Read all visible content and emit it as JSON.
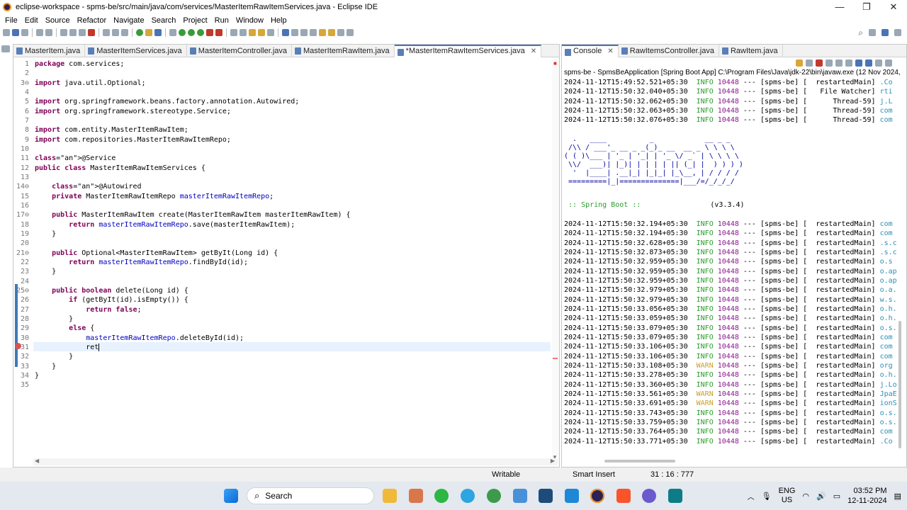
{
  "window": {
    "title": "eclipse-workspace - spms-be/src/main/java/com/services/MasterItemRawItemServices.java - Eclipse IDE",
    "controls": {
      "minimize": "—",
      "maximize": "❐",
      "close": "✕"
    }
  },
  "menu": [
    "File",
    "Edit",
    "Source",
    "Refactor",
    "Navigate",
    "Search",
    "Project",
    "Run",
    "Window",
    "Help"
  ],
  "editor": {
    "tabs": [
      {
        "label": "MasterItem.java"
      },
      {
        "label": "MasterItemServices.java"
      },
      {
        "label": "MasterItemController.java"
      },
      {
        "label": "MasterItemRawItem.java"
      },
      {
        "label": "*MasterItemRawItemServices.java",
        "active": true
      }
    ],
    "line_numbers": [
      "1",
      "2",
      "3⊖",
      "4",
      "5",
      "6",
      "7",
      "8",
      "9",
      "10",
      "11",
      "12",
      "13",
      "14⊖",
      "15",
      "16",
      "17⊖",
      "18",
      "19",
      "20",
      "21⊖",
      "22",
      "23",
      "24",
      "25⊖",
      "26",
      "27",
      "28",
      "29",
      "30",
      "31",
      "32",
      "33",
      "34",
      "35"
    ],
    "lines": [
      "package com.services;",
      "",
      "import java.util.Optional;",
      "",
      "import org.springframework.beans.factory.annotation.Autowired;",
      "import org.springframework.stereotype.Service;",
      "",
      "import com.entity.MasterItemRawItem;",
      "import com.repositories.MasterItemRawItemRepo;",
      "",
      "@Service",
      "public class MasterItemRawItemServices {",
      "",
      "    @Autowired",
      "    private MasterItemRawItemRepo masterItemRawItemRepo;",
      "",
      "    public MasterItemRawItem create(MasterItemRawItem masterItemRawItem) {",
      "        return masterItemRawItemRepo.save(masterItemRawItem);",
      "    }",
      "",
      "    public Optional<MasterItemRawItem> getByIt(Long id) {",
      "        return masterItemRawItemRepo.findById(id);",
      "    }",
      "",
      "    public boolean delete(Long id) {",
      "        if (getByIt(id).isEmpty()) {",
      "            return false;",
      "        }",
      "        else {",
      "            masterItemRawItemRepo.deleteById(id);",
      "            ret",
      "        }",
      "    }",
      "}",
      ""
    ]
  },
  "console": {
    "tabs": [
      {
        "label": "Console",
        "active": true
      },
      {
        "label": "RawItemsController.java"
      },
      {
        "label": "RawItem.java"
      }
    ],
    "header": "spms-be - SpmsBeApplication [Spring Boot App] C:\\Program Files\\Java\\jdk-22\\bin\\javaw.exe  (12 Nov 2024,",
    "log_top": [
      {
        "ts": "2024-11-12T15:49:52.521+05:30",
        "lvl": "INFO",
        "pid": "10448",
        "thread": "restartedMain",
        "lg": ".Co"
      },
      {
        "ts": "2024-11-12T15:50:32.040+05:30",
        "lvl": "INFO",
        "pid": "10448",
        "thread": "File Watcher",
        "lg": "rti"
      },
      {
        "ts": "2024-11-12T15:50:32.062+05:30",
        "lvl": "INFO",
        "pid": "10448",
        "thread": "Thread-59",
        "lg": "j.L"
      },
      {
        "ts": "2024-11-12T15:50:32.063+05:30",
        "lvl": "INFO",
        "pid": "10448",
        "thread": "Thread-59",
        "lg": "com"
      },
      {
        "ts": "2024-11-12T15:50:32.076+05:30",
        "lvl": "INFO",
        "pid": "10448",
        "thread": "Thread-59",
        "lg": "com"
      }
    ],
    "banner": [
      "  .   ____          _            __ _ _",
      " /\\\\ / ___'_ __ _ _(_)_ __  __ _ \\ \\ \\ \\",
      "( ( )\\___ | '_ | '_| | '_ \\/ _` | \\ \\ \\ \\",
      " \\\\/  ___)| |_)| | | | | || (_| |  ) ) ) )",
      "  '  |____| .__|_| |_|_| |_\\__, | / / / /",
      " =========|_|==============|___/=/_/_/_/"
    ],
    "spring_boot_label": " :: Spring Boot ::",
    "spring_boot_version": "(v3.3.4)",
    "log_bottom": [
      {
        "ts": "2024-11-12T15:50:32.194+05:30",
        "lvl": "INFO",
        "pid": "10448",
        "thread": "restartedMain",
        "lg": "com"
      },
      {
        "ts": "2024-11-12T15:50:32.194+05:30",
        "lvl": "INFO",
        "pid": "10448",
        "thread": "restartedMain",
        "lg": "com"
      },
      {
        "ts": "2024-11-12T15:50:32.628+05:30",
        "lvl": "INFO",
        "pid": "10448",
        "thread": "restartedMain",
        "lg": ".s.c"
      },
      {
        "ts": "2024-11-12T15:50:32.873+05:30",
        "lvl": "INFO",
        "pid": "10448",
        "thread": "restartedMain",
        "lg": ".s.c"
      },
      {
        "ts": "2024-11-12T15:50:32.959+05:30",
        "lvl": "INFO",
        "pid": "10448",
        "thread": "restartedMain",
        "lg": "o.s"
      },
      {
        "ts": "2024-11-12T15:50:32.959+05:30",
        "lvl": "INFO",
        "pid": "10448",
        "thread": "restartedMain",
        "lg": "o.ap"
      },
      {
        "ts": "2024-11-12T15:50:32.959+05:30",
        "lvl": "INFO",
        "pid": "10448",
        "thread": "restartedMain",
        "lg": "o.ap"
      },
      {
        "ts": "2024-11-12T15:50:32.979+05:30",
        "lvl": "INFO",
        "pid": "10448",
        "thread": "restartedMain",
        "lg": "o.a."
      },
      {
        "ts": "2024-11-12T15:50:32.979+05:30",
        "lvl": "INFO",
        "pid": "10448",
        "thread": "restartedMain",
        "lg": "w.s."
      },
      {
        "ts": "2024-11-12T15:50:33.056+05:30",
        "lvl": "INFO",
        "pid": "10448",
        "thread": "restartedMain",
        "lg": "o.h."
      },
      {
        "ts": "2024-11-12T15:50:33.059+05:30",
        "lvl": "INFO",
        "pid": "10448",
        "thread": "restartedMain",
        "lg": "o.h."
      },
      {
        "ts": "2024-11-12T15:50:33.079+05:30",
        "lvl": "INFO",
        "pid": "10448",
        "thread": "restartedMain",
        "lg": "o.s."
      },
      {
        "ts": "2024-11-12T15:50:33.079+05:30",
        "lvl": "INFO",
        "pid": "10448",
        "thread": "restartedMain",
        "lg": "com"
      },
      {
        "ts": "2024-11-12T15:50:33.106+05:30",
        "lvl": "INFO",
        "pid": "10448",
        "thread": "restartedMain",
        "lg": "com"
      },
      {
        "ts": "2024-11-12T15:50:33.106+05:30",
        "lvl": "INFO",
        "pid": "10448",
        "thread": "restartedMain",
        "lg": "com"
      },
      {
        "ts": "2024-11-12T15:50:33.108+05:30",
        "lvl": "WARN",
        "pid": "10448",
        "thread": "restartedMain",
        "lg": "org"
      },
      {
        "ts": "2024-11-12T15:50:33.278+05:30",
        "lvl": "INFO",
        "pid": "10448",
        "thread": "restartedMain",
        "lg": "o.h."
      },
      {
        "ts": "2024-11-12T15:50:33.360+05:30",
        "lvl": "INFO",
        "pid": "10448",
        "thread": "restartedMain",
        "lg": "j.Lo"
      },
      {
        "ts": "2024-11-12T15:50:33.561+05:30",
        "lvl": "WARN",
        "pid": "10448",
        "thread": "restartedMain",
        "lg": "JpaE"
      },
      {
        "ts": "2024-11-12T15:50:33.691+05:30",
        "lvl": "WARN",
        "pid": "10448",
        "thread": "restartedMain",
        "lg": "ionS"
      },
      {
        "ts": "2024-11-12T15:50:33.743+05:30",
        "lvl": "INFO",
        "pid": "10448",
        "thread": "restartedMain",
        "lg": "o.s."
      },
      {
        "ts": "2024-11-12T15:50:33.759+05:30",
        "lvl": "INFO",
        "pid": "10448",
        "thread": "restartedMain",
        "lg": "o.s."
      },
      {
        "ts": "2024-11-12T15:50:33.764+05:30",
        "lvl": "INFO",
        "pid": "10448",
        "thread": "restartedMain",
        "lg": "com"
      },
      {
        "ts": "2024-11-12T15:50:33.771+05:30",
        "lvl": "INFO",
        "pid": "10448",
        "thread": "restartedMain",
        "lg": ".Co"
      }
    ]
  },
  "status": {
    "writable": "Writable",
    "insert_mode": "Smart Insert",
    "position": "31 : 16 : 777"
  },
  "taskbar": {
    "search_label": "Search",
    "language": "ENG",
    "region": "US",
    "time": "03:52 PM",
    "date": "12-11-2024"
  }
}
